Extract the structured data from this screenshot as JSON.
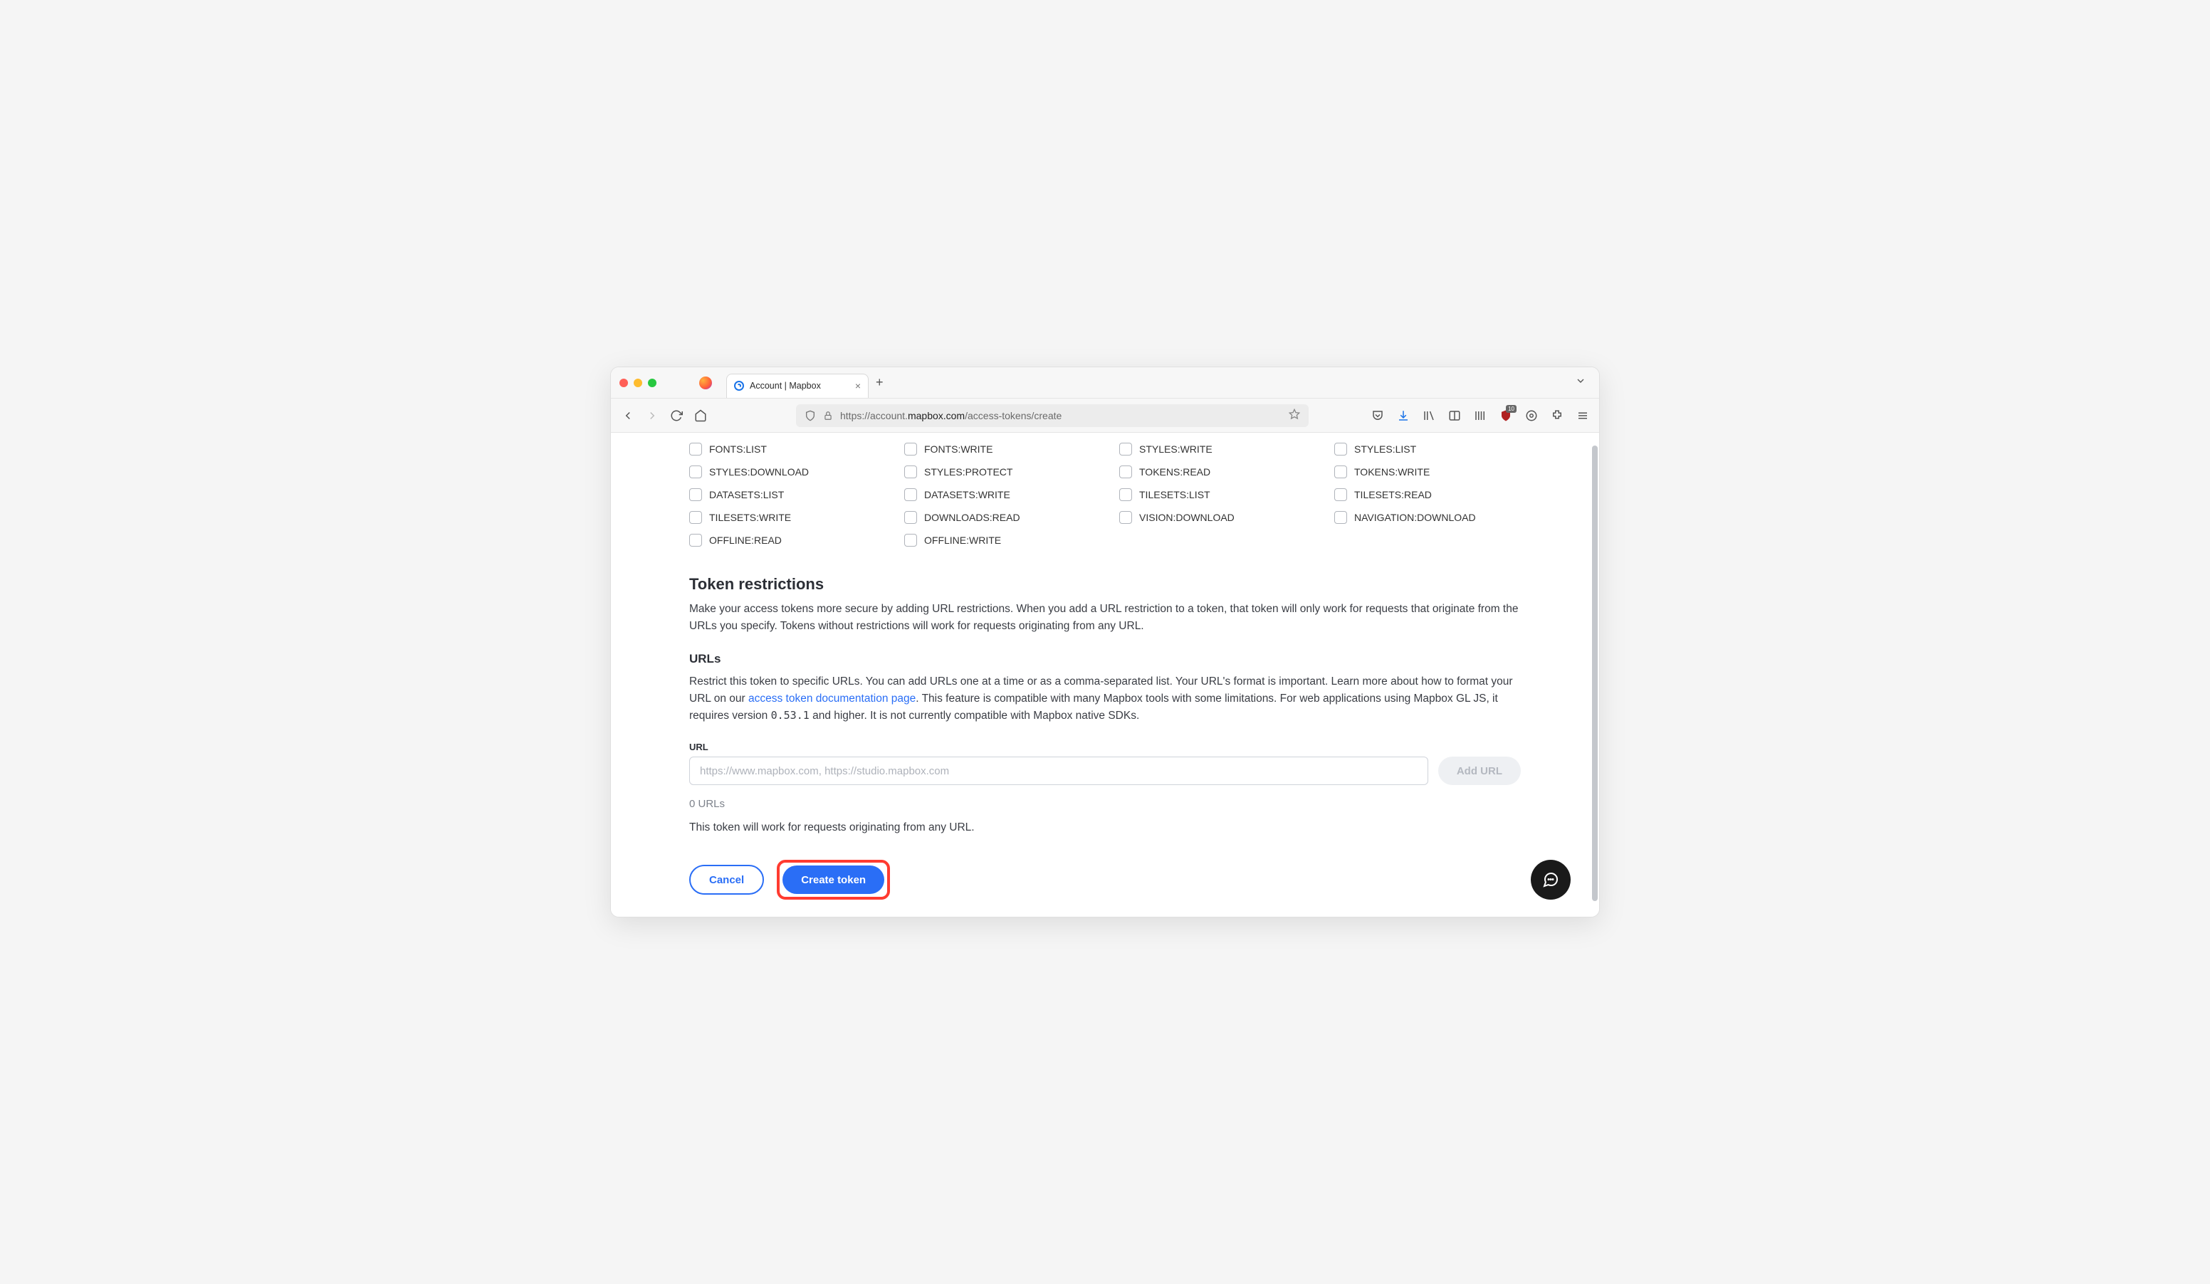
{
  "browser": {
    "tab_title": "Account | Mapbox",
    "url_prefix": "https://account.",
    "url_domain": "mapbox.com",
    "url_path": "/access-tokens/create",
    "badge": "10"
  },
  "scopes": [
    "FONTS:LIST",
    "FONTS:WRITE",
    "STYLES:WRITE",
    "STYLES:LIST",
    "STYLES:DOWNLOAD",
    "STYLES:PROTECT",
    "TOKENS:READ",
    "TOKENS:WRITE",
    "DATASETS:LIST",
    "DATASETS:WRITE",
    "TILESETS:LIST",
    "TILESETS:READ",
    "TILESETS:WRITE",
    "DOWNLOADS:READ",
    "VISION:DOWNLOAD",
    "NAVIGATION:DOWNLOAD",
    "OFFLINE:READ",
    "OFFLINE:WRITE"
  ],
  "restrictions": {
    "heading": "Token restrictions",
    "desc": "Make your access tokens more secure by adding URL restrictions. When you add a URL restriction to a token, that token will only work for requests that originate from the URLs you specify. Tokens without restrictions will work for requests originating from any URL.",
    "urls_heading": "URLs",
    "urls_desc_a": "Restrict this token to specific URLs. You can add URLs one at a time or as a comma-separated list. Your URL's format is important. Learn more about how to format your URL on our ",
    "urls_link": "access token documentation page",
    "urls_desc_b": ". This feature is compatible with many Mapbox tools with some limitations. For web applications using Mapbox GL JS, it requires version ",
    "version": "0.53.1",
    "urls_desc_c": " and higher. It is not currently compatible with Mapbox native SDKs.",
    "url_label": "URL",
    "url_placeholder": "https://www.mapbox.com, https://studio.mapbox.com",
    "add_url": "Add URL",
    "url_count": "0 URLs",
    "url_note": "This token will work for requests originating from any URL."
  },
  "actions": {
    "cancel": "Cancel",
    "create": "Create token"
  }
}
